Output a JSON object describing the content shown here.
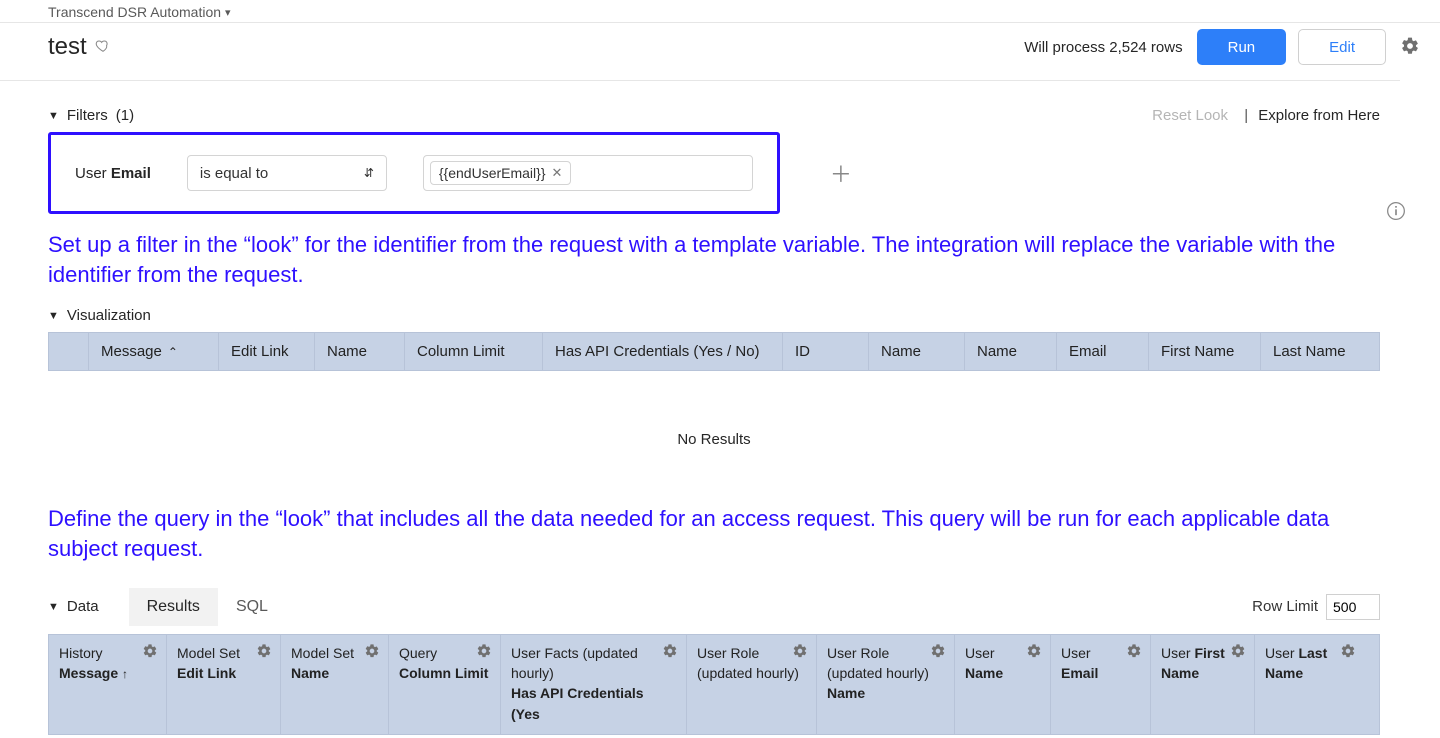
{
  "workspace": {
    "name": "Transcend DSR Automation"
  },
  "page": {
    "title": "test"
  },
  "header": {
    "process_msg": "Will process 2,524 rows",
    "run_label": "Run",
    "edit_label": "Edit"
  },
  "filters": {
    "section_label": "Filters",
    "count_suffix": "(1)",
    "reset_label": "Reset Look",
    "explore_label": "Explore from Here",
    "row": {
      "field_scope": "User",
      "field_name": "Email",
      "operator": "is equal to",
      "chip_value": "{{endUserEmail}}"
    }
  },
  "annotations": {
    "filter_note": "Set up a filter in the “look” for the identifier from the request with a template variable. The integration will replace the variable with the identifier from the request.",
    "query_note": "Define the query in the “look” that includes all the data needed for an access request. This query will be run for each applicable data subject request."
  },
  "visualization": {
    "section_label": "Visualization",
    "no_results": "No Results",
    "columns": [
      "Message",
      "Edit Link",
      "Name",
      "Column Limit",
      "Has API Credentials (Yes / No)",
      "ID",
      "Name",
      "Name",
      "Email",
      "First Name",
      "Last Name"
    ]
  },
  "data": {
    "section_label": "Data",
    "tabs": {
      "results": "Results",
      "sql": "SQL"
    },
    "row_limit_label": "Row Limit",
    "row_limit_value": "500",
    "columns": [
      {
        "g": "History",
        "f": "Message",
        "sort_up": true
      },
      {
        "g": "Model Set",
        "f": "Edit Link"
      },
      {
        "g": "Model Set",
        "f": "Name"
      },
      {
        "g": "Query",
        "f": "Column Limit"
      },
      {
        "g": "User Facts (updated hourly)",
        "f": "Has API Credentials (Yes"
      },
      {
        "g": "User Role (updated hourly)",
        "f": ""
      },
      {
        "g": "User Role (updated hourly)",
        "f": "Name"
      },
      {
        "g": "User",
        "f": "Name"
      },
      {
        "g": "User",
        "f": "Email"
      },
      {
        "g_pre": "User ",
        "g_bold": "First",
        "f": "Name",
        "inline": true
      },
      {
        "g_pre": "User ",
        "g_bold": "Last",
        "f": "Name",
        "inline": true
      }
    ]
  }
}
